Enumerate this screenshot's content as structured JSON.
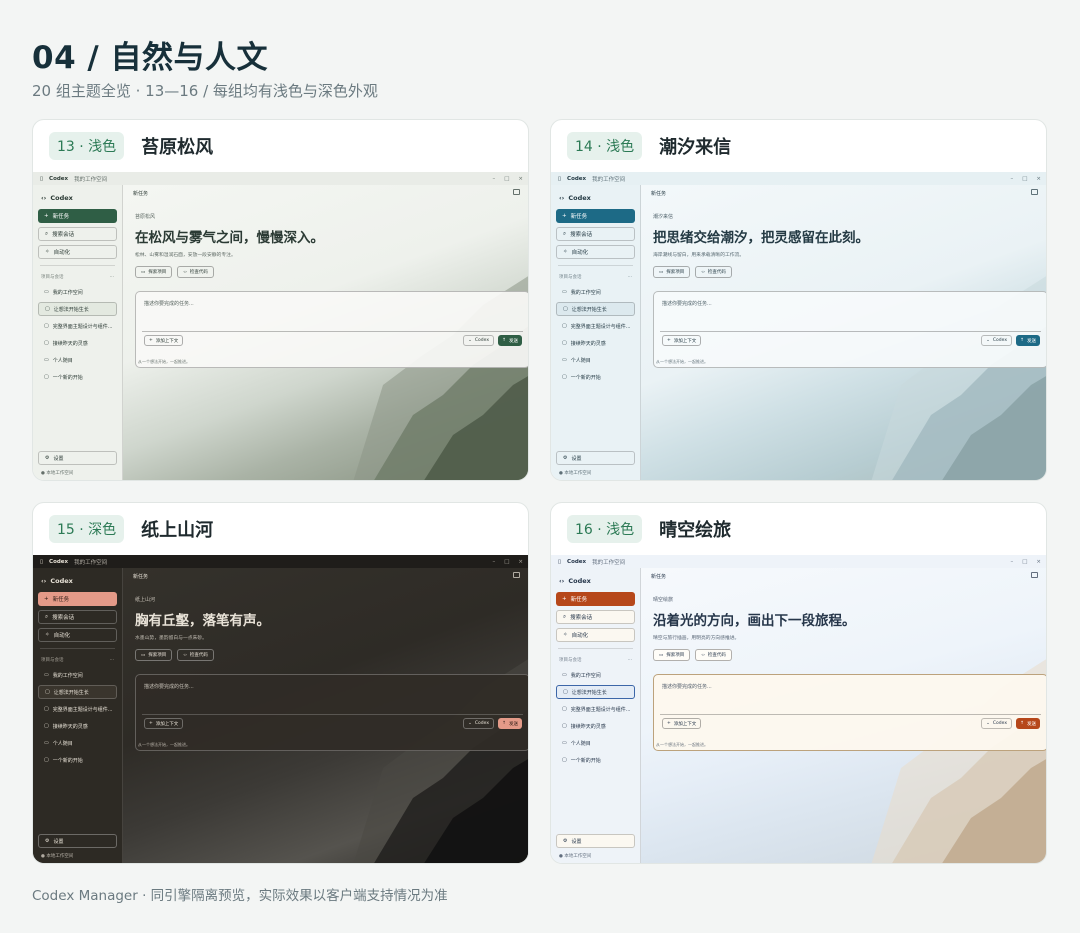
{
  "header": {
    "title": "04 / 自然与人文",
    "subtitle": "20 组主题全览 · 13—16 / 每组均有浅色与深色外观"
  },
  "footer": {
    "text": "Codex Manager · 同引擎隔离预览，实际效果以客户端支持情况为准"
  },
  "app_common": {
    "app_name": "Codex",
    "workspace": "我的工作空间",
    "new_task": "新任务",
    "search": "搜索会话",
    "automation": "自动化",
    "projects_section": "项目与会话",
    "projects_more": "···",
    "sidebar_items": [
      "我的工作空间",
      "让想法开始生长",
      "完整界面主题设计与组件...",
      "接续昨天的灵感",
      "个人随目",
      "一个新的开始"
    ],
    "settings": "设置",
    "local_workspace": "本地工作空间",
    "explore": "探索项目",
    "check_code": "检查代码",
    "composer_placeholder": "描述你要完成的任务...",
    "add_context": "添加上下文",
    "model": "Codex",
    "send": "发送",
    "hint": "从一个想法开始，一起推进。"
  },
  "themes": [
    {
      "badge": "13 · 浅色",
      "name": "苔原松风",
      "kicker": "苔原松风",
      "hero_title": "在松风与雾气之间，慢慢深入。",
      "hero_desc": "松林、山雾和湿润石面，安放一段安静的专注。",
      "accent": "#2f5e45"
    },
    {
      "badge": "14 · 浅色",
      "name": "潮汐来信",
      "kicker": "潮汐来信",
      "hero_title": "把思绪交给潮汐，把灵感留在此刻。",
      "hero_desc": "海岸潮线与留白，用来承载清晰的工作流。",
      "accent": "#1d6a86"
    },
    {
      "badge": "15 · 深色",
      "name": "纸上山河",
      "kicker": "纸上山河",
      "hero_title": "胸有丘壑，落笔有声。",
      "hero_desc": "水墨山势，墨韵留白与一点朱砂。",
      "accent": "#e49a88"
    },
    {
      "badge": "16 · 浅色",
      "name": "晴空绘旅",
      "kicker": "晴空绘旅",
      "hero_title": "沿着光的方向，画出下一段旅程。",
      "hero_desc": "晴空与旅行插画，用明亮的方向感推进。",
      "accent": "#b6471a"
    }
  ]
}
